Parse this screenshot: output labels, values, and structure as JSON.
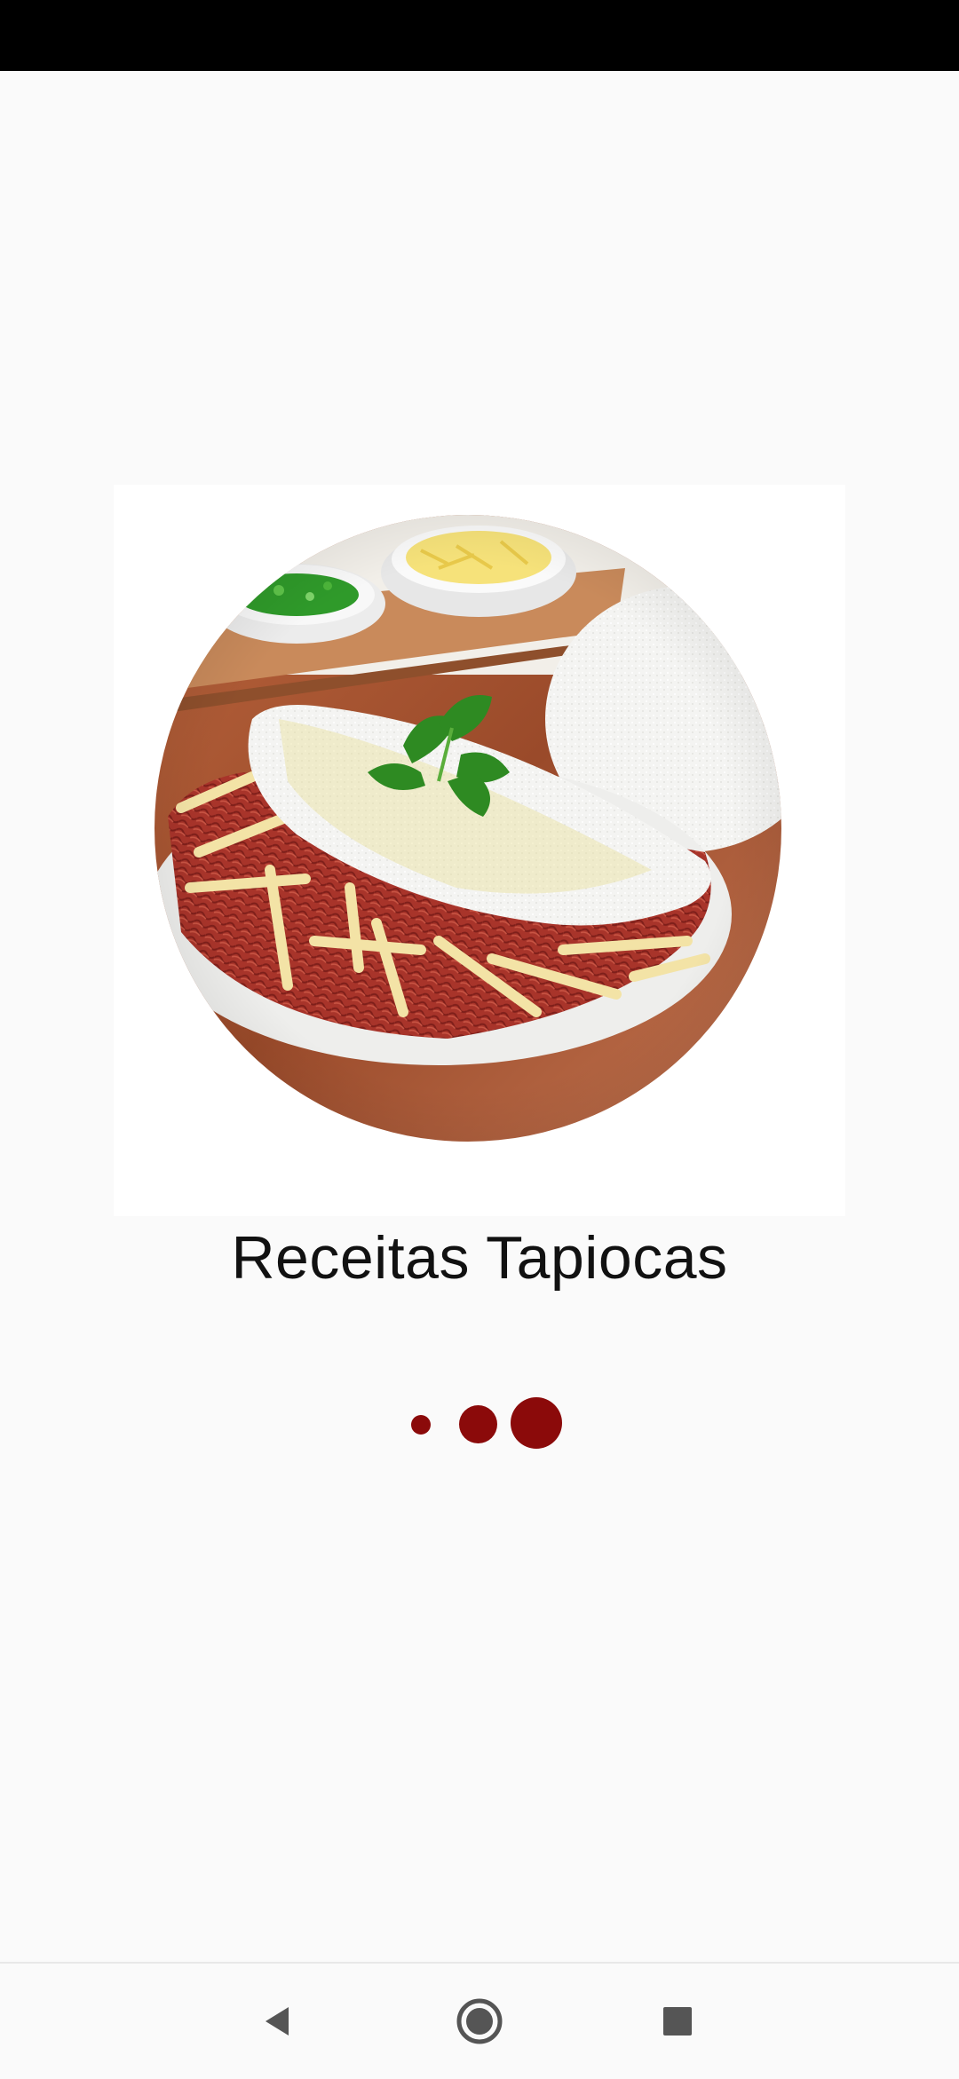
{
  "app": {
    "title": "Receitas Tapiocas"
  },
  "loader": {
    "color": "#8b0a0a",
    "dots": 3
  },
  "hero_image": {
    "subject": "tapioca-with-shredded-meat-and-cheese"
  },
  "nav": {
    "back_icon": "back-triangle-icon",
    "home_icon": "home-circle-icon",
    "recents_icon": "recents-square-icon",
    "icon_color": "#555555"
  },
  "colors": {
    "background": "#fafafa",
    "status_bar": "#000000",
    "accent": "#8b0a0a"
  }
}
